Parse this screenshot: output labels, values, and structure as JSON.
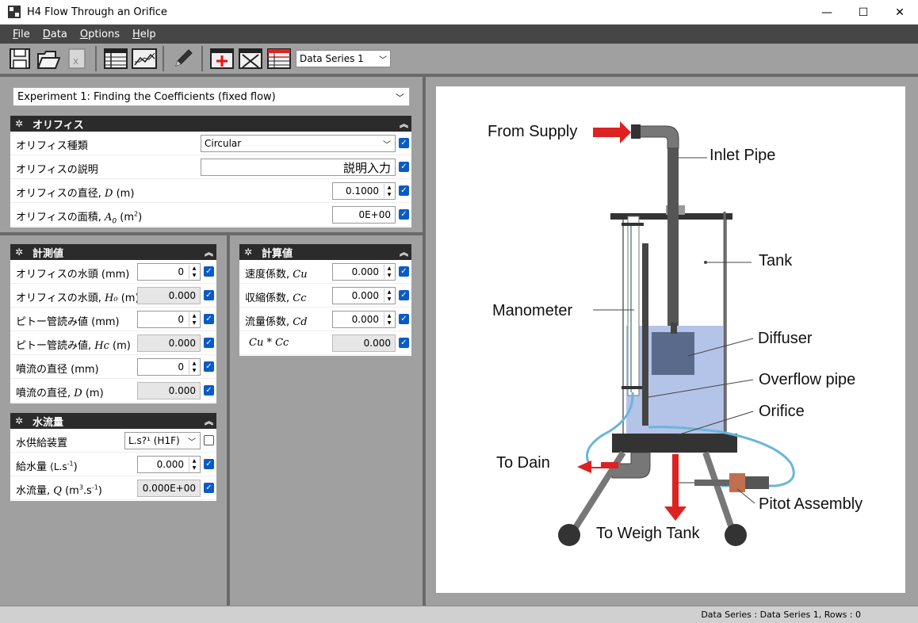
{
  "window": {
    "title": "H4 Flow Through an Orifice",
    "controls": [
      "—",
      "☐",
      "✕"
    ]
  },
  "menu": [
    {
      "key": "F",
      "rest": "ile"
    },
    {
      "key": "D",
      "rest": "ata"
    },
    {
      "key": "O",
      "rest": "ptions"
    },
    {
      "key": "H",
      "rest": "elp"
    }
  ],
  "toolbar": {
    "series_value": "Data Series 1"
  },
  "experiment": {
    "value": "Experiment 1: Finding the Coefficients (fixed flow)"
  },
  "orifice_panel": {
    "title": "オリフィス",
    "type_label": "オリフィス種類",
    "type_value": "Circular",
    "desc_label": "オリフィスの説明",
    "desc_value": "説明入力",
    "diam_label": "オリフィスの直径, ",
    "diam_sym": "D",
    "diam_unit": " (m)",
    "diam_value": "0.1000",
    "area_label": "オリフィスの面積, ",
    "area_sym": "A",
    "area_sub": "0",
    "area_unit": " (m",
    "area_sup": "2",
    "area_close": ")",
    "area_value": "0E+00"
  },
  "measured_panel": {
    "title": "計測値",
    "rows": [
      {
        "label": "オリフィスの水頭 ",
        "sym": "",
        "unit": "(mm)",
        "value": "0",
        "kind": "spin"
      },
      {
        "label": "オリフィスの水頭, ",
        "sym": "H₀",
        "unit": " (m)",
        "value": "0.000",
        "kind": "ro"
      },
      {
        "label": "ピトー管読み値 ",
        "sym": "",
        "unit": "(mm)",
        "value": "0",
        "kind": "spin"
      },
      {
        "label": "ピトー管読み値, ",
        "sym": "Hc",
        "unit": " (m)",
        "value": "0.000",
        "kind": "ro"
      },
      {
        "label": "噴流の直径 ",
        "sym": "",
        "unit": "(mm)",
        "value": "0",
        "kind": "spin"
      },
      {
        "label": "噴流の直径, ",
        "sym": "D",
        "unit": " (m)",
        "value": "0.000",
        "kind": "ro"
      }
    ]
  },
  "calc_panel": {
    "title": "計算値",
    "rows": [
      {
        "label": "速度係数, ",
        "sym": "Cu",
        "value": "0.000",
        "kind": "spin"
      },
      {
        "label": "収縮係数, ",
        "sym": "Cc",
        "value": "0.000",
        "kind": "spin"
      },
      {
        "label": "流量係数, ",
        "sym": "Cd",
        "value": "0.000",
        "kind": "spin"
      },
      {
        "label": "",
        "sym": "Cu * Cc",
        "value": "0.000",
        "kind": "ro"
      }
    ]
  },
  "flow_panel": {
    "title": "水流量",
    "supply_label": "水供給装置",
    "supply_value": "L.s?¹ (H1F)",
    "rate_label": "給水量 ",
    "rate_unit": "(L.s",
    "rate_sup": "-1",
    "rate_close": ")",
    "rate_value": "0.000",
    "q_label": "水流量, ",
    "q_sym": "Q",
    "q_unit": " (m",
    "q_sup1": "3",
    "q_mid": ".s",
    "q_sup2": "-1",
    "q_close": ")",
    "q_value": "0.000E+00"
  },
  "diagram": {
    "labels": {
      "from_supply": "From Supply",
      "inlet_pipe": "Inlet Pipe",
      "tank": "Tank",
      "manometer": "Manometer",
      "diffuser": "Diffuser",
      "overflow_pipe": "Overflow pipe",
      "orifice": "Orifice",
      "to_drain": "To Dain",
      "pitot_assembly": "Pitot Assembly",
      "to_weigh_tank": "To Weigh Tank"
    }
  },
  "status": {
    "text": "Data Series : Data Series 1,  Rows : 0"
  }
}
